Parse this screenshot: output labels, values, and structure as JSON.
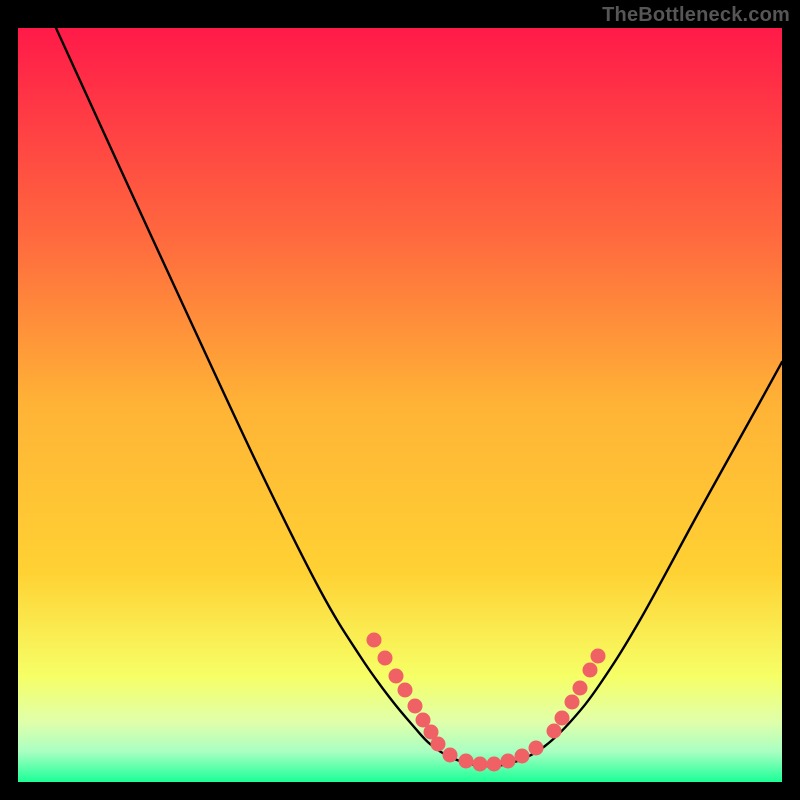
{
  "watermark": "TheBottleneck.com",
  "colors": {
    "black": "#000000",
    "curve": "#000000",
    "dots": "#f06166",
    "gradient_top": "#ff1a49",
    "gradient_mid1": "#ff7e3b",
    "gradient_mid2": "#ffd133",
    "gradient_mid3": "#ffff33",
    "gradient_mid4": "#e8ffb0",
    "gradient_mid5": "#b6ffc8",
    "gradient_bottom": "#1bff97"
  },
  "chart_data": {
    "type": "line",
    "title": "",
    "xlabel": "",
    "ylabel": "",
    "xlim": [
      18,
      782
    ],
    "ylim": [
      28,
      782
    ],
    "series": [
      {
        "name": "curve",
        "points": [
          [
            56,
            28
          ],
          [
            120,
            168
          ],
          [
            190,
            320
          ],
          [
            260,
            470
          ],
          [
            320,
            590
          ],
          [
            360,
            656
          ],
          [
            390,
            698
          ],
          [
            415,
            728
          ],
          [
            430,
            744
          ],
          [
            448,
            756
          ],
          [
            470,
            764
          ],
          [
            495,
            766
          ],
          [
            520,
            760
          ],
          [
            545,
            746
          ],
          [
            572,
            720
          ],
          [
            600,
            684
          ],
          [
            640,
            620
          ],
          [
            700,
            510
          ],
          [
            760,
            402
          ],
          [
            782,
            362
          ]
        ]
      }
    ],
    "dots": [
      [
        374,
        640
      ],
      [
        385,
        658
      ],
      [
        396,
        676
      ],
      [
        405,
        690
      ],
      [
        415,
        706
      ],
      [
        423,
        720
      ],
      [
        431,
        732
      ],
      [
        438,
        744
      ],
      [
        450,
        755
      ],
      [
        466,
        761
      ],
      [
        480,
        764
      ],
      [
        494,
        764
      ],
      [
        508,
        761
      ],
      [
        522,
        756
      ],
      [
        536,
        748
      ],
      [
        554,
        731
      ],
      [
        562,
        718
      ],
      [
        572,
        702
      ],
      [
        580,
        688
      ],
      [
        590,
        670
      ],
      [
        598,
        656
      ]
    ]
  }
}
